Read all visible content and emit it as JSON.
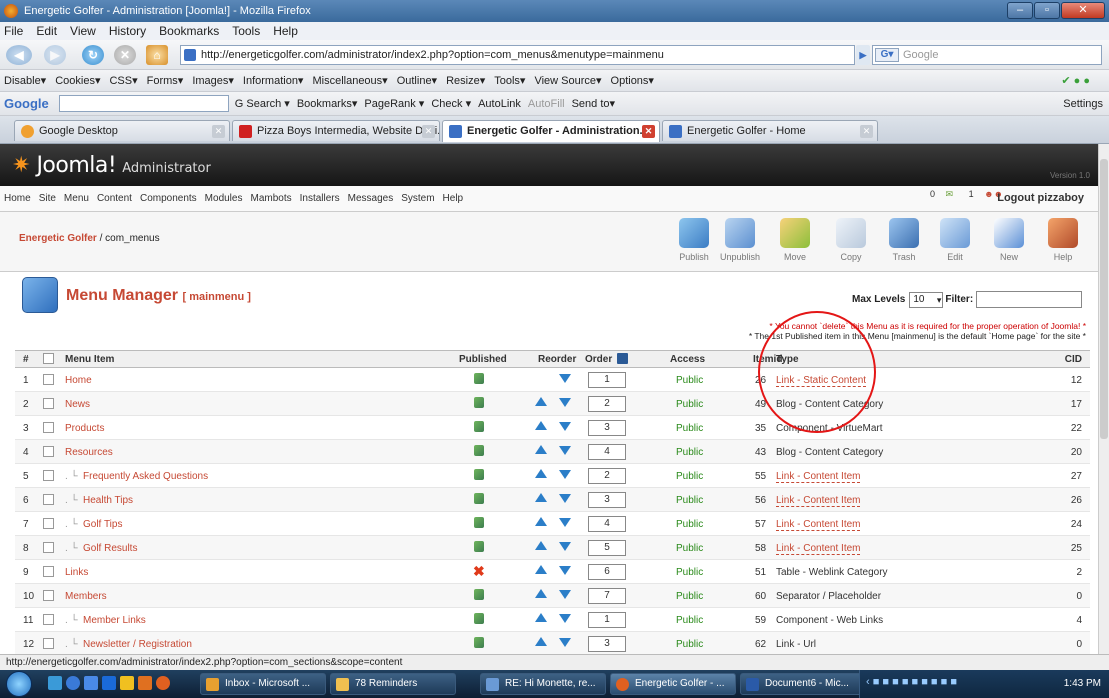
{
  "browser": {
    "title": "Energetic Golfer - Administration [Joomla!] - Mozilla Firefox",
    "menu": [
      "File",
      "Edit",
      "View",
      "History",
      "Bookmarks",
      "Tools",
      "Help"
    ],
    "url": "http://energeticgolfer.com/administrator/index2.php?option=com_menus&menutype=mainmenu",
    "search_placeholder": "Google",
    "webdev": [
      "Disable▾",
      "Cookies▾",
      "CSS▾",
      "Forms▾",
      "Images▾",
      "Information▾",
      "Miscellaneous▾",
      "Outline▾",
      "Resize▾",
      "Tools▾",
      "View Source▾",
      "Options▾"
    ],
    "google_bar": {
      "logo": "Google",
      "items": [
        "G Search ▾",
        "Bookmarks▾",
        "PageRank ▾",
        "Check ▾",
        "AutoLink",
        "AutoFill",
        "Send to▾"
      ],
      "settings": "Settings"
    },
    "tabs": [
      "Google Desktop",
      "Pizza Boys Intermedia, Website Desi...",
      "Energetic Golfer - Administration...",
      "Energetic Golfer - Home"
    ],
    "status": "http://energeticgolfer.com/administrator/index2.php?option=com_sections&scope=content"
  },
  "joomla": {
    "logo": "Joomla!",
    "logo_sub": "Administrator",
    "version": "Version 1.0",
    "admin_menu": [
      "Home",
      "Site",
      "Menu",
      "Content",
      "Components",
      "Modules",
      "Mambots",
      "Installers",
      "Messages",
      "System",
      "Help"
    ],
    "msg_count": "0",
    "user_count": "1",
    "logout": "Logout pizzaboy",
    "crumb_site": "Energetic Golfer",
    "crumb_rest": " / com_menus",
    "toolbar": [
      "Publish",
      "Unpublish",
      "Move",
      "Copy",
      "Trash",
      "Edit",
      "New",
      "Help"
    ],
    "page_title": "Menu Manager",
    "page_sub": "[ mainmenu ]",
    "max_levels_label": "Max Levels",
    "max_levels_value": "10",
    "filter_label": "Filter:",
    "note1": "* You cannot `delete` this Menu as it is required for the proper operation of Joomla! *",
    "note2": "* The 1st Published item in this Menu [mainmenu] is the default `Home page` for the site *",
    "columns": {
      "num": "#",
      "item": "Menu Item",
      "published": "Published",
      "reorder": "Reorder",
      "order": "Order",
      "access": "Access",
      "itemid": "Itemid",
      "type": "Type",
      "cid": "CID"
    },
    "rows": [
      {
        "num": "1",
        "name": "Home",
        "indent": "",
        "pub": true,
        "up": false,
        "order": "1",
        "access": "Public",
        "itemid": "26",
        "type": "Link - Static Content",
        "link": true,
        "cid": "12"
      },
      {
        "num": "2",
        "name": "News",
        "indent": "",
        "pub": true,
        "up": true,
        "order": "2",
        "access": "Public",
        "itemid": "49",
        "type": "Blog - Content Category",
        "link": false,
        "cid": "17"
      },
      {
        "num": "3",
        "name": "Products",
        "indent": "",
        "pub": true,
        "up": true,
        "order": "3",
        "access": "Public",
        "itemid": "35",
        "type": "Component - VirtueMart",
        "link": false,
        "cid": "22"
      },
      {
        "num": "4",
        "name": "Resources",
        "indent": "",
        "pub": true,
        "up": true,
        "order": "4",
        "access": "Public",
        "itemid": "43",
        "type": "Blog - Content Category",
        "link": false,
        "cid": "20"
      },
      {
        "num": "5",
        "name": "Frequently Asked Questions",
        "indent": ". └",
        "pub": true,
        "up": true,
        "order": "2",
        "access": "Public",
        "itemid": "55",
        "type": "Link - Content Item",
        "link": true,
        "cid": "27"
      },
      {
        "num": "6",
        "name": "Health Tips",
        "indent": ". └",
        "pub": true,
        "up": true,
        "order": "3",
        "access": "Public",
        "itemid": "56",
        "type": "Link - Content Item",
        "link": true,
        "cid": "26"
      },
      {
        "num": "7",
        "name": "Golf Tips",
        "indent": ". └",
        "pub": true,
        "up": true,
        "order": "4",
        "access": "Public",
        "itemid": "57",
        "type": "Link - Content Item",
        "link": true,
        "cid": "24"
      },
      {
        "num": "8",
        "name": "Golf Results",
        "indent": ". └",
        "pub": true,
        "up": true,
        "order": "5",
        "access": "Public",
        "itemid": "58",
        "type": "Link - Content Item",
        "link": true,
        "cid": "25"
      },
      {
        "num": "9",
        "name": "Links",
        "indent": "",
        "pub": false,
        "up": true,
        "order": "6",
        "access": "Public",
        "itemid": "51",
        "type": "Table - Weblink Category",
        "link": false,
        "cid": "2"
      },
      {
        "num": "10",
        "name": "Members",
        "indent": "",
        "pub": true,
        "up": true,
        "order": "7",
        "access": "Public",
        "itemid": "60",
        "type": "Separator / Placeholder",
        "link": false,
        "cid": "0"
      },
      {
        "num": "11",
        "name": "Member Links",
        "indent": ". └",
        "pub": true,
        "up": true,
        "order": "1",
        "access": "Public",
        "itemid": "59",
        "type": "Component - Web Links",
        "link": false,
        "cid": "4"
      },
      {
        "num": "12",
        "name": "Newsletter / Registration",
        "indent": ". └",
        "pub": true,
        "up": true,
        "order": "3",
        "access": "Public",
        "itemid": "62",
        "type": "Link - Url",
        "link": false,
        "cid": "0"
      }
    ]
  },
  "taskbar": {
    "items": [
      "Inbox - Microsoft ...",
      "78 Reminders",
      "RE: Hi Monette, re...",
      "Energetic Golfer - ...",
      "Document6 - Mic..."
    ],
    "clock": "1:43 PM"
  },
  "colors": {
    "accent": "#c64934",
    "public": "#2a8a1a",
    "annotation": "#e41616"
  }
}
